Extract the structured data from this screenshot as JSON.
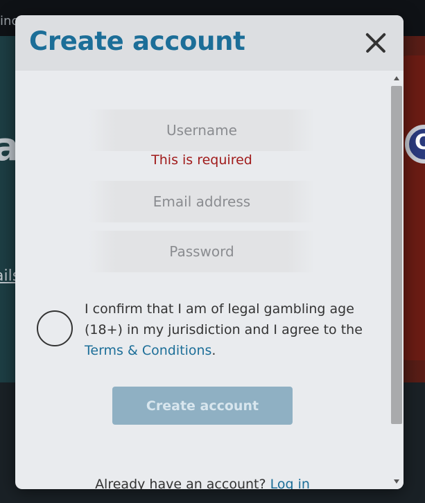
{
  "background": {
    "top_left_text": "inc",
    "left_text_1": "as",
    "left_text_2": "ails",
    "right_text": "C"
  },
  "modal": {
    "title": "Create account",
    "close_icon": "close-icon",
    "username": {
      "placeholder": "Username",
      "value": "",
      "error": "This is required"
    },
    "email": {
      "placeholder": "Email address",
      "value": ""
    },
    "password": {
      "placeholder": "Password",
      "value": ""
    },
    "consent": {
      "text_before": "I confirm that I am of legal gambling age (18+) in my jurisdiction and I agree to the ",
      "link": "Terms & Conditions",
      "text_after": ".",
      "checked": false
    },
    "submit_label": "Create account",
    "footer": {
      "text": "Already have an account? ",
      "link": "Log in"
    }
  },
  "colors": {
    "accent": "#1c6e98",
    "error": "#a01a1a",
    "button_disabled": "#8fb0c3"
  }
}
